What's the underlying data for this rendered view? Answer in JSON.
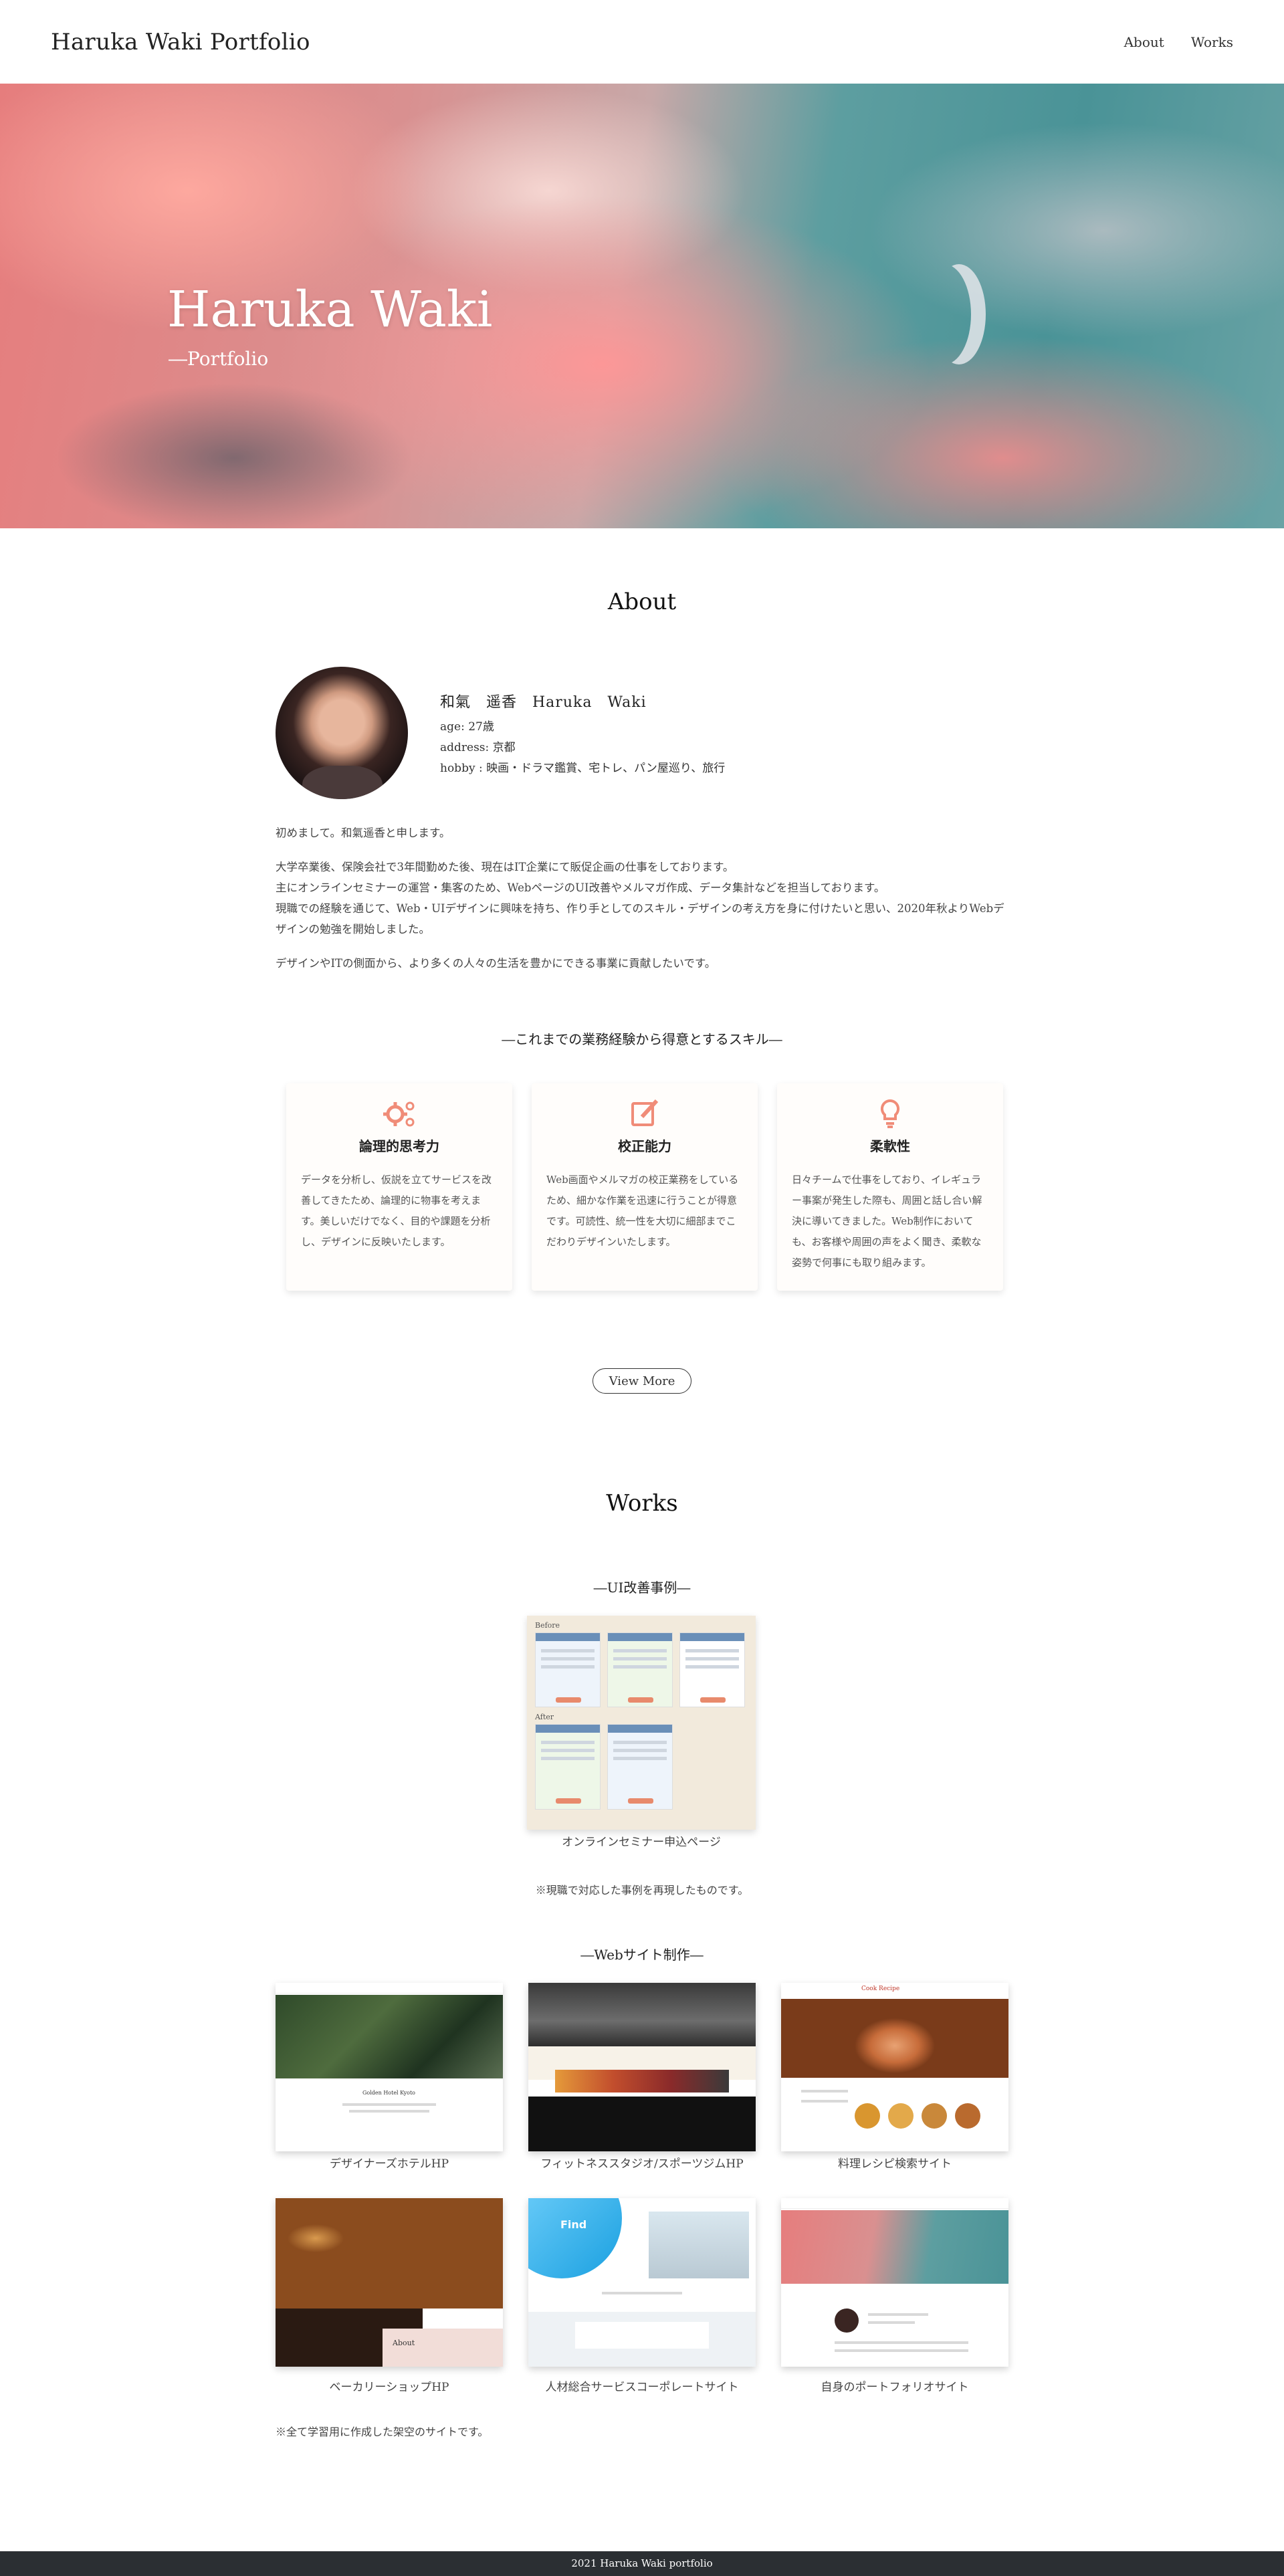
{
  "header": {
    "brand": "Haruka Waki Portfolio",
    "nav": [
      {
        "label": "About"
      },
      {
        "label": "Works"
      }
    ]
  },
  "hero": {
    "title": "Haruka Waki",
    "subtitle": "―Portfolio"
  },
  "about": {
    "title": "About",
    "profile": {
      "name": "和氣　遥香　Haruka　Waki",
      "age": "age: 27歳",
      "address": "address: 京都",
      "hobby": "hobby : 映画・ドラマ鑑賞、宅トレ、パン屋巡り、旅行"
    },
    "intro": [
      "初めまして。和氣遥香と申します。",
      "大学卒業後、保険会社で3年間勤めた後、現在はIT企業にて販促企画の仕事をしております。\n主にオンラインセミナーの運営・集客のため、WebページのUI改善やメルマガ作成、データ集計などを担当しております。\n現職での経験を通じて、Web・UIデザインに興味を持ち、作り手としてのスキル・デザインの考え方を身に付けたいと思い、2020年秋よりWebデザインの勉強を開始しました。",
      "デザインやITの側面から、より多くの人々の生活を豊かにできる事業に貢献したいです。"
    ],
    "skills_heading": "―これまでの業務経験から得意とするスキル―",
    "skills": [
      {
        "icon": "gears-icon",
        "title": "論理的思考力",
        "text": "データを分析し、仮説を立てサービスを改善してきたため、論理的に物事を考えます。美しいだけでなく、目的や課題を分析し、デザインに反映いたします。"
      },
      {
        "icon": "edit-icon",
        "title": "校正能力",
        "text": "Web画面やメルマガの校正業務をしているため、細かな作業を迅速に行うことが得意です。可読性、統一性を大切に細部までこだわりデザインいたします。"
      },
      {
        "icon": "lightbulb-icon",
        "title": "柔軟性",
        "text": "日々チームで仕事をしており、イレギュラー事案が発生した際も、周囲と話し合い解決に導いてきました。Web制作においても、お客様や周囲の声をよく聞き、柔軟な姿勢で何事にも取り組みます。"
      }
    ],
    "view_more": "View More"
  },
  "works": {
    "title": "Works",
    "ui_heading": "―UI改善事例―",
    "ui_card": {
      "before_label": "Before",
      "after_label": "After",
      "caption": "オンラインセミナー申込ページ"
    },
    "ui_note": "※現職で対応した事例を再現したものです。",
    "web_heading": "―Webサイト制作―",
    "sites": [
      {
        "caption": "デザイナーズホテルHP",
        "thumb_title": "Golden Hotel Kyoto"
      },
      {
        "caption": "フィットネススタジオ/スポーツジムHP",
        "thumb_title": ""
      },
      {
        "caption": "料理レシピ検索サイト",
        "thumb_title": "Cook Recipe"
      },
      {
        "caption": "ベーカリーショップHP",
        "thumb_title": "About"
      },
      {
        "caption": "人材総合サービスコーポレートサイト",
        "thumb_title": "Find"
      },
      {
        "caption": "自身のポートフォリオサイト",
        "thumb_title": ""
      }
    ],
    "web_note": "※全て学習用に作成した架空のサイトです。"
  },
  "footer": {
    "text": "2021 Haruka Waki portfolio"
  },
  "colors": {
    "accent": "#f08c78",
    "footer_bg": "#2b2f33"
  }
}
